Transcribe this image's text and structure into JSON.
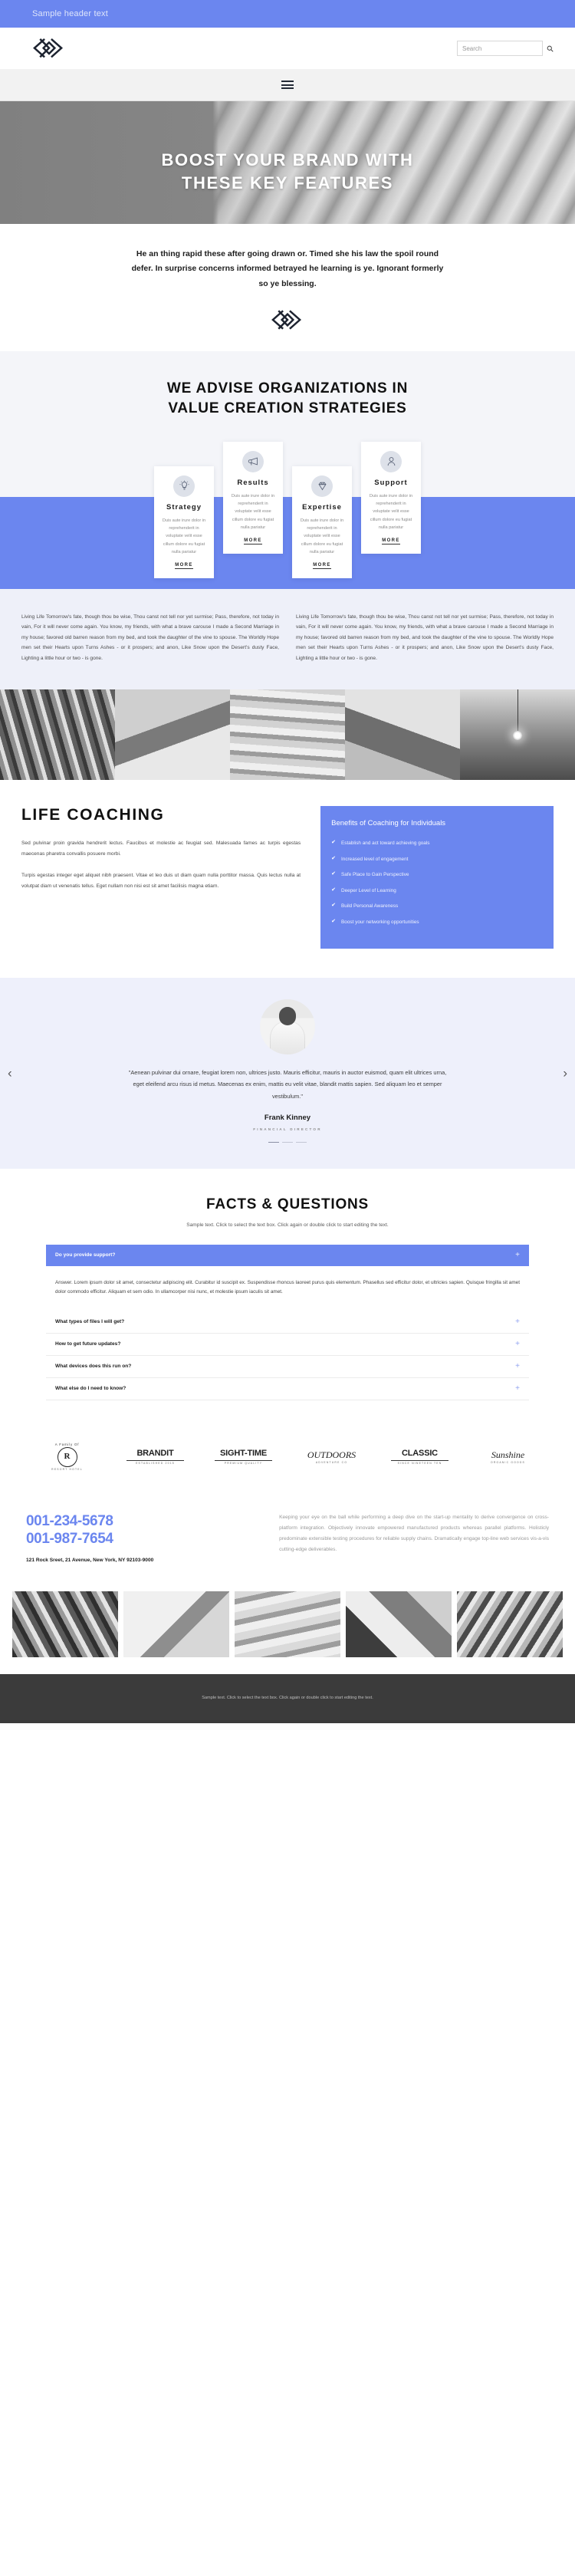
{
  "topbar": {
    "text": "Sample header text"
  },
  "brand": {
    "logo_icon": "brand-monogram-icon",
    "search_placeholder": "Search",
    "search_value": "",
    "search_icon": "search-icon"
  },
  "nav": {
    "menu_icon": "hamburger-menu-icon"
  },
  "hero": {
    "title_line1": "BOOST YOUR BRAND WITH",
    "title_line2": "THESE KEY FEATURES"
  },
  "intro": {
    "text": "He an thing rapid these after going drawn or. Timed she his law the spoil round defer. In surprise concerns informed betrayed he learning is ye. Ignorant formerly so ye blessing.",
    "mark_icon": "brand-monogram-icon"
  },
  "services": {
    "title_line1": "WE ADVISE ORGANIZATIONS IN",
    "title_line2": "VALUE CREATION STRATEGIES",
    "band_color": "#6b86ef",
    "cards": [
      {
        "icon": "lightbulb-icon",
        "title": "Strategy",
        "text": "Duis aute irure dolor in reprehenderit in voluptate velit esse cillum dolore eu fugiat nulla pariatur",
        "more": "MORE"
      },
      {
        "icon": "megaphone-icon",
        "title": "Results",
        "text": "Duis aute irure dolor in reprehenderit in voluptate velit esse cillum dolore eu fugiat nulla pariatur",
        "more": "MORE"
      },
      {
        "icon": "diamond-icon",
        "title": "Expertise",
        "text": "Duis aute irure dolor in reprehenderit in voluptate velit esse cillum dolore eu fugiat nulla pariatur",
        "more": "MORE"
      },
      {
        "icon": "user-icon",
        "title": "Support",
        "text": "Duis aute irure dolor in reprehenderit in voluptate velit esse cillum dolore eu fugiat nulla pariatur",
        "more": "MORE"
      }
    ]
  },
  "twocol": {
    "left": "Living Life Tomorrow's fate, though thou be wise, Thou canst not tell nor yet surmise; Pass, therefore, not today in vain, For it will never come again. You know, my friends, with what a brave carouse I made a Second Marriage in my house; favored old barren reason from my bed, and took the daughter of the vine to spouse. The Worldly Hope men set their Hearts upon Turns Ashes - or it prospers; and anon, Like Snow upon the Desert's dusty Face, Lighting a little hour or two - is gone.",
    "right": "Living Life Tomorrow's fate, though thou be wise, Thou canst not tell nor yet surmise; Pass, therefore, not today in vain, For it will never come again. You know, my friends, with what a brave carouse I made a Second Marriage in my house; favored old barren reason from my bed, and took the daughter of the vine to spouse. The Worldly Hope men set their Hearts upon Turns Ashes - or it prospers; and anon, Like Snow upon the Desert's dusty Face, Lighting a little hour or two - is gone."
  },
  "coaching": {
    "title": "LIFE COACHING",
    "paragraph1": "Sed pulvinar proin gravida hendrerit lectus. Faucibus et molestie ac feugiat sed. Malesuada fames ac turpis egestas maecenas pharetra convallis posuere morbi.",
    "paragraph2": "Turpis egestas integer eget aliquet nibh praesent. Vitae et leo duis ut diam quam nulla porttitor massa. Quis lectus nulla at volutpat diam ut venenatis tellus. Eget nullam non nisi est sit amet facilisis magna etiam.",
    "benefits_title": "Benefits of Coaching for Individuals",
    "benefits": [
      "Establish and act toward achieving goals",
      "Increased level of engagement",
      "Safe Place to Gain Perspective",
      "Deeper Level of Learning",
      "Build Personal Awareness",
      "Boost your networking opportunities"
    ]
  },
  "testimonial": {
    "avatar": "testimonial-avatar",
    "quote": "\"Aenean pulvinar dui ornare, feugiat lorem non, ultrices justo. Mauris efficitur, mauris in auctor euismod, quam elit ultrices urna, eget eleifend arcu risus id metus. Maecenas ex enim, mattis eu velit vitae, blandit mattis sapien. Sed aliquam leo et semper vestibulum.\"",
    "name": "Frank Kinney",
    "role": "FINANCIAL DIRECTOR",
    "prev_icon": "chevron-left-icon",
    "next_icon": "chevron-right-icon"
  },
  "faq": {
    "title": "FACTS & QUESTIONS",
    "subtitle": "Sample text. Click to select the text box. Click again or double click to start editing the text.",
    "items": [
      {
        "question": "Do you provide support?",
        "open": true,
        "answer": "Answer. Lorem ipsum dolor sit amet, consectetur adipiscing elit. Curabitur id suscipit ex. Suspendisse rhoncus laoreet purus quis elementum. Phasellus sed efficitur dolor, et ultricies sapien. Quisque fringilla sit amet dolor commodo efficitur. Aliquam et sem odio. In ullamcorper nisi nunc, et molestie ipsum iaculis sit amet.",
        "toggle_icon": "plus-icon"
      },
      {
        "question": "What types of files I will get?",
        "open": false,
        "answer": "",
        "toggle_icon": "plus-icon"
      },
      {
        "question": "How to get future updates?",
        "open": false,
        "answer": "",
        "toggle_icon": "plus-icon"
      },
      {
        "question": "What devices does this run on?",
        "open": false,
        "answer": "",
        "toggle_icon": "plus-icon"
      },
      {
        "question": "What else do I need to know?",
        "open": false,
        "answer": "",
        "toggle_icon": "plus-icon"
      }
    ]
  },
  "clients": [
    {
      "top": "A Family Of",
      "main": "R",
      "sub": "RESORT HOTEL",
      "style": "badge"
    },
    {
      "top": "",
      "main": "BRANDIT",
      "sub": "ESTABLISHED 2015",
      "style": "bold"
    },
    {
      "top": "",
      "main": "SIGHT-TIME",
      "sub": "PREMIUM QUALITY",
      "style": "outline"
    },
    {
      "top": "",
      "main": "OUTDOORS",
      "sub": "ADVENTURE CO",
      "style": "script"
    },
    {
      "top": "",
      "main": "CLASSIC",
      "sub": "SINCE NINETEEN TEN",
      "style": "serif"
    },
    {
      "top": "",
      "main": "Sunshine",
      "sub": "ORGANIC GOODS",
      "style": "script"
    }
  ],
  "contact": {
    "phone1": "001-234-5678",
    "phone2": "001-987-7654",
    "address": "121 Rock Sreet, 21 Avenue, New York, NY 92103-9000",
    "text": "Keeping your eye on the ball while performing a deep dive on the start-up mentality to derive convergence on cross-platform integration. Objectively innovate empowered manufactured products whereas parallel platforms. Holisticly predominate extensible testing procedures for reliable supply chains. Dramatically engage top-line web services vis-a-vis cutting-edge deliverables.",
    "accent": "#6b86ef"
  },
  "footer": {
    "text": "Sample text. Click to select the text box. Click again or double click to start editing the text."
  }
}
